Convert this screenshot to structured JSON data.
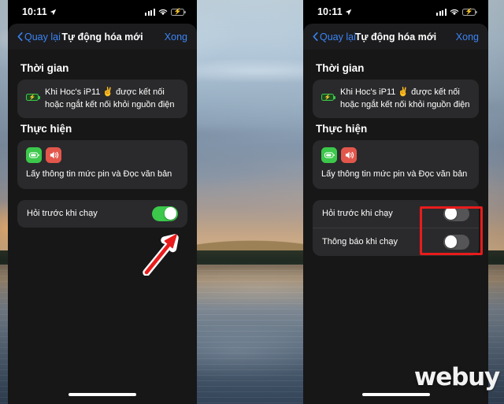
{
  "statusbar": {
    "time": "10:11",
    "location_icon": "location-arrow-icon",
    "signal_icon": "cellular-signal-icon",
    "wifi_icon": "wifi-icon",
    "battery_icon": "battery-charging-icon"
  },
  "navbar": {
    "back_label": "Quay lại",
    "title": "Tự động hóa mới",
    "done_label": "Xong"
  },
  "sections": {
    "trigger_title": "Thời gian",
    "trigger_text": "Khi Hoc's iP11 ✌️ được kết nối hoặc ngắt kết nối khỏi nguồn điện",
    "trigger_icon": "battery-charging-icon",
    "action_title": "Thực hiện",
    "action_text": "Lấy thông tin mức pin và Đọc văn bản",
    "action_icon_battery": "battery-level-icon",
    "action_icon_speaker": "speaker-volume-icon"
  },
  "left_panel": {
    "toggles": [
      {
        "label": "Hỏi trước khi chạy",
        "state": "on"
      }
    ]
  },
  "right_panel": {
    "toggles": [
      {
        "label": "Hỏi trước khi chạy",
        "state": "off"
      },
      {
        "label": "Thông báo khi chạy",
        "state": "off"
      }
    ]
  },
  "annotations": {
    "arrow_color": "#e81c1c",
    "arrow_outline_color": "#ffffff",
    "rect_color": "#e81c1c",
    "arrow_name": "red-arrow-annotation",
    "rect_name": "red-rectangle-annotation"
  },
  "watermark": {
    "text": "webuy"
  },
  "colors": {
    "accent_blue": "#3b85f5",
    "toggle_on_green": "#3cc84b",
    "toggle_off_gray": "#555558",
    "card_bg": "#2a2a2c",
    "screen_bg": "#171717",
    "annotation_red": "#e81c1c"
  }
}
